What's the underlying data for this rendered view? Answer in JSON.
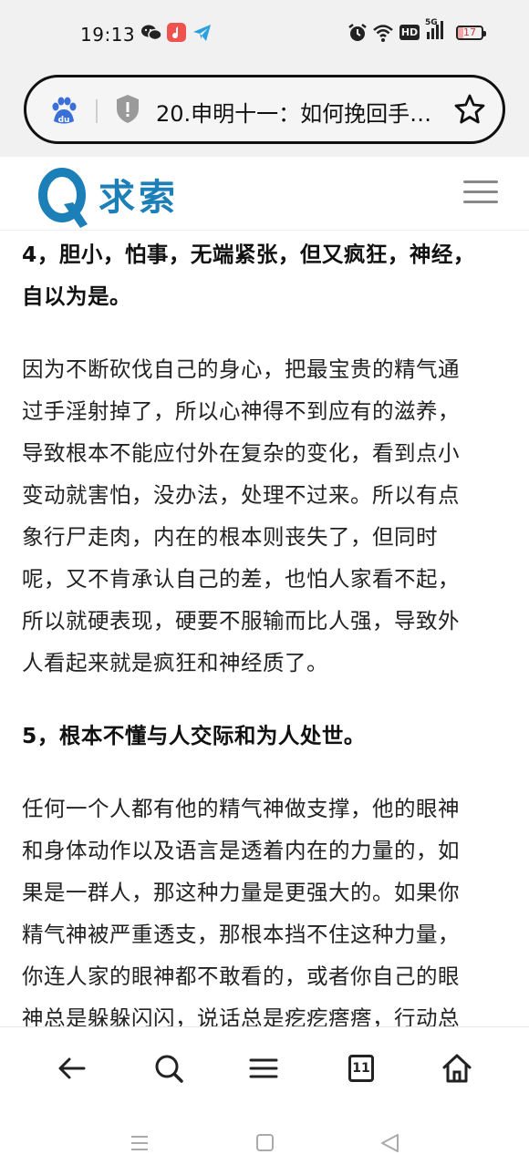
{
  "status_bar": {
    "time": "19:13",
    "network": "5G",
    "hd_label": "HD",
    "battery_level": "17",
    "icons": [
      "wechat-icon",
      "music-app-icon",
      "telegram-icon",
      "alarm-icon",
      "wifi-icon",
      "hd-icon",
      "signal-icon",
      "battery-icon"
    ]
  },
  "address_bar": {
    "title": "20.申明十一：如何挽回手…",
    "icons": [
      "baidu-paw-icon",
      "shield-icon",
      "star-icon"
    ]
  },
  "site": {
    "logo_letter": "Q",
    "logo_text": "求索",
    "brand_color": "#1c7fb7"
  },
  "article": {
    "heading4_line1": "4，胆小，怕事，无端紧张，但又疯狂，神经，",
    "heading4_line2": "自以为是。",
    "para1_lines": [
      "因为不断砍伐自己的身心，把最宝贵的精气通",
      "过手淫射掉了，所以心神得不到应有的滋养，",
      "导致根本不能应付外在复杂的变化，看到点小",
      "变动就害怕，没办法，处理不过来。所以有点",
      "象行尸走肉，内在的根本则丧失了，但同时",
      "呢，又不肯承认自己的差，也怕人家看不起，",
      "所以就硬表现，硬要不服输而比人强，导致外",
      "人看起来就是疯狂和神经质了。"
    ],
    "heading5": "5，根本不懂与人交际和为人处世。",
    "para2_lines": [
      "任何一个人都有他的精气神做支撑，他的眼神",
      "和身体动作以及语言是透着内在的力量的，如",
      "果是一群人，那这种力量是更强大的。如果你",
      "精气神被严重透支，那根本挡不住这种力量，",
      "你连人家的眼神都不敢看的，或者你自己的眼",
      "神总是躲躲闪闪，说话总是疙疙瘩瘩，行动总"
    ]
  },
  "toolbar": {
    "tab_count": "11",
    "icons": [
      "back-arrow-icon",
      "search-icon",
      "menu-icon",
      "tabs-icon",
      "home-icon"
    ]
  },
  "system_nav": {
    "icons": [
      "recent-apps-icon",
      "home-square-icon",
      "back-triangle-icon"
    ]
  }
}
